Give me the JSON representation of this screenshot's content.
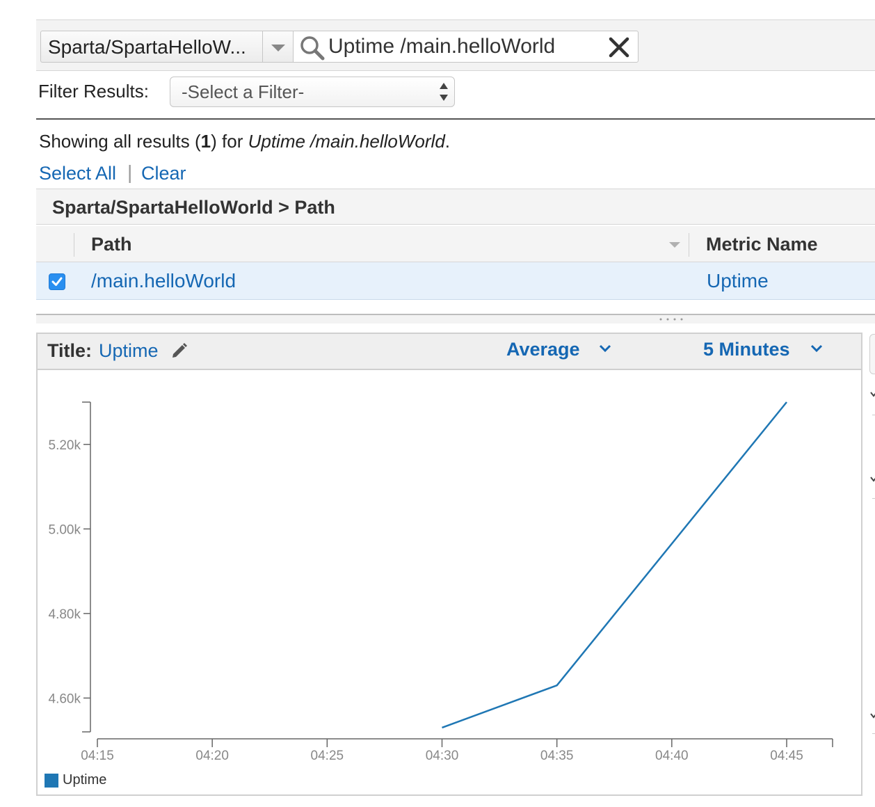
{
  "search": {
    "namespace": "Sparta/SpartaHelloW...",
    "query": "Uptime /main.helloWorld"
  },
  "filter": {
    "label": "Filter Results:",
    "selected": "-Select a Filter-"
  },
  "results": {
    "prefix": "Showing all results (",
    "count": "1",
    "middle": ") for ",
    "query": "Uptime /main.helloWorld",
    "suffix": ".",
    "select_all": "Select All",
    "separator": "|",
    "clear": "Clear"
  },
  "table": {
    "group_title": "Sparta/SpartaHelloWorld > Path",
    "columns": [
      "Path",
      "Metric Name"
    ],
    "rows": [
      {
        "path": "/main.helloWorld",
        "metric": "Uptime",
        "checked": true
      }
    ]
  },
  "graph": {
    "title_label": "Title:",
    "title_value": "Uptime",
    "statistic": "Average",
    "period": "5 Minutes",
    "icons": {
      "edit": "pencil-icon",
      "dropdown": "chevron-down-icon"
    }
  },
  "chart_data": {
    "type": "line",
    "title": "Uptime",
    "x_ticks": [
      "04:15",
      "04:20",
      "04:25",
      "04:30",
      "04:35",
      "04:40",
      "04:45"
    ],
    "y_ticks": [
      "4.60k",
      "5.00k",
      "5.20k",
      "4.80k"
    ],
    "ylim": [
      4520,
      5300
    ],
    "series": [
      {
        "name": "Uptime",
        "color": "#1f77b4",
        "x": [
          "04:30",
          "04:35",
          "04:45"
        ],
        "values": [
          4530,
          4630,
          5300
        ]
      }
    ],
    "legend": [
      "Uptime"
    ],
    "legend_position": "bottom-left",
    "grid": false
  }
}
